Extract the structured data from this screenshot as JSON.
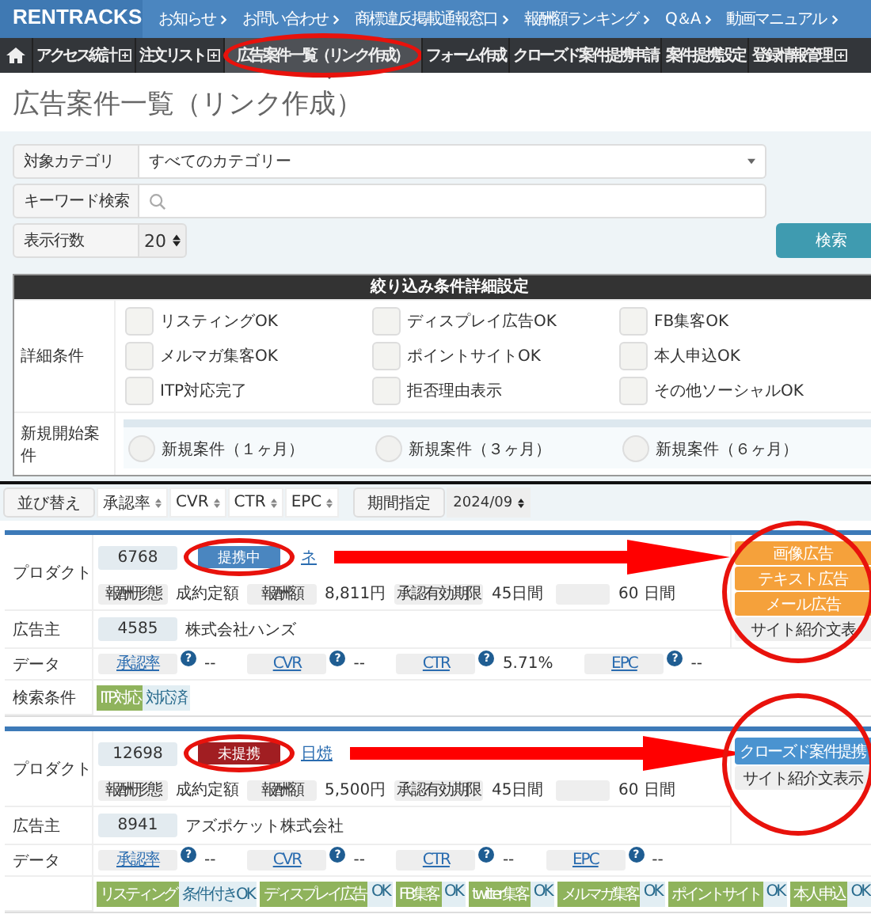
{
  "header": {
    "logo": "RENTRACKS",
    "links": [
      "お知らせ",
      "お問い合わせ",
      "商標違反掲載通報窓口",
      "報酬額ランキング",
      "Q＆A",
      "動画マニュアル"
    ]
  },
  "nav": [
    {
      "label": "アクセス統計",
      "expandable": true,
      "selected": false,
      "circled": false
    },
    {
      "label": "注文リスト",
      "expandable": true,
      "selected": false,
      "circled": false
    },
    {
      "label": "広告案件一覧（リンク作成）",
      "expandable": false,
      "selected": true,
      "circled": true
    },
    {
      "label": "フォーム作成",
      "expandable": false,
      "selected": false,
      "circled": false
    },
    {
      "label": "クローズド案件提携申請",
      "expandable": false,
      "selected": false,
      "circled": false
    },
    {
      "label": "案件提携設定",
      "expandable": false,
      "selected": false,
      "circled": false
    },
    {
      "label": "登録情報管理",
      "expandable": true,
      "selected": false,
      "circled": false
    }
  ],
  "page_title": "広告案件一覧（リンク作成）",
  "filters": {
    "category": {
      "label": "対象カテゴリ",
      "value": "すべてのカテゴリー"
    },
    "keyword": {
      "label": "キーワード検索"
    },
    "rows": {
      "label": "表示行数",
      "value": "20"
    },
    "search_button": "検索"
  },
  "detail_panel": {
    "title": "絞り込み条件詳細設定",
    "conditions_label": "詳細条件",
    "checkboxes": [
      {
        "label": "リスティングOK",
        "checked": false
      },
      {
        "label": "ディスプレイ広告OK",
        "checked": false
      },
      {
        "label": "FB集客OK",
        "checked": false
      },
      {
        "label": "メルマガ集客OK",
        "checked": false
      },
      {
        "label": "ポイントサイトOK",
        "checked": false
      },
      {
        "label": "本人申込OK",
        "checked": false
      },
      {
        "label": "ITP対応完了",
        "checked": false
      },
      {
        "label": "拒否理由表示",
        "checked": false
      },
      {
        "label": "その他ソーシャルOK",
        "checked": false
      }
    ],
    "new_label": "新規開始案件",
    "radios": [
      {
        "label": "新規案件（１ヶ月）",
        "selected": false
      },
      {
        "label": "新規案件（３ヶ月）",
        "selected": false
      },
      {
        "label": "新規案件（６ヶ月）",
        "selected": false
      }
    ]
  },
  "sort_bar": {
    "label": "並び替え",
    "options": [
      "承認率",
      "CVR",
      "CTR",
      "EPC"
    ],
    "period_label": "期間指定",
    "period_value": "2024/09"
  },
  "products": [
    {
      "labels": {
        "product": "プロダクト",
        "advertiser": "広告主",
        "data": "データ",
        "search": "検索条件"
      },
      "id": "6768",
      "status": {
        "kind": "active",
        "label": "提携中"
      },
      "link": "ネ",
      "annotated": true,
      "fields": [
        {
          "label": "報酬形態",
          "value": "成約定額"
        },
        {
          "label": "報酬額",
          "value": "8,811円"
        },
        {
          "label": "承認有効期限",
          "value": "45日間"
        },
        {
          "value": "60 日間"
        }
      ],
      "advertiser_id": "4585",
      "advertiser": "株式会社ハンズ",
      "data": [
        {
          "label": "承認率",
          "hint": "?",
          "value": "--"
        },
        {
          "label": "CVR",
          "hint": "?",
          "value": "--"
        },
        {
          "label": "CTR",
          "hint": "?",
          "value": "5.71%"
        },
        {
          "label": "EPC",
          "hint": "?",
          "value": "--"
        }
      ],
      "tags": [
        {
          "name": "ITP対応",
          "value": "対応済"
        }
      ],
      "actions": [
        {
          "kind": "ad",
          "label": "画像広告"
        },
        {
          "kind": "ad",
          "label": "テキスト広告"
        },
        {
          "kind": "ad",
          "label": "メール広告"
        },
        {
          "kind": "plain",
          "label": "サイト紹介文表"
        }
      ]
    },
    {
      "labels": {
        "product": "プロダクト",
        "advertiser": "広告主",
        "data": "データ"
      },
      "id": "12698",
      "status": {
        "kind": "inactive",
        "label": "未提携"
      },
      "link": "日焼",
      "annotated": true,
      "fields": [
        {
          "label": "報酬形態",
          "value": "成約定額"
        },
        {
          "label": "報酬額",
          "value": "5,500円"
        },
        {
          "label": "承認有効期限",
          "value": "45日間"
        },
        {
          "value": "60 日間"
        }
      ],
      "advertiser_id": "8941",
      "advertiser": "アズポケット株式会社",
      "data": [
        {
          "label": "承認率",
          "hint": "?",
          "value": "--"
        },
        {
          "label": "CVR",
          "hint": "?",
          "value": "--"
        },
        {
          "label": "CTR",
          "hint": "?",
          "value": "--"
        },
        {
          "label": "EPC",
          "hint": "?",
          "value": "--"
        }
      ],
      "tags": [
        {
          "name": "リスティング",
          "value": "条件付きOK"
        },
        {
          "name": "ディスプレイ広告",
          "value": "OK"
        },
        {
          "name": "FB集客",
          "value": "OK"
        },
        {
          "name": "twitter集客",
          "value": "OK"
        },
        {
          "name": "メルマガ集客",
          "value": "OK"
        },
        {
          "name": "ポイントサイト",
          "value": "OK"
        },
        {
          "name": "本人申込",
          "value": "OK"
        }
      ],
      "actions": [
        {
          "kind": "apply",
          "label": "クローズド案件提携"
        },
        {
          "kind": "plain",
          "label": "サイト紹介文表示"
        }
      ]
    }
  ]
}
